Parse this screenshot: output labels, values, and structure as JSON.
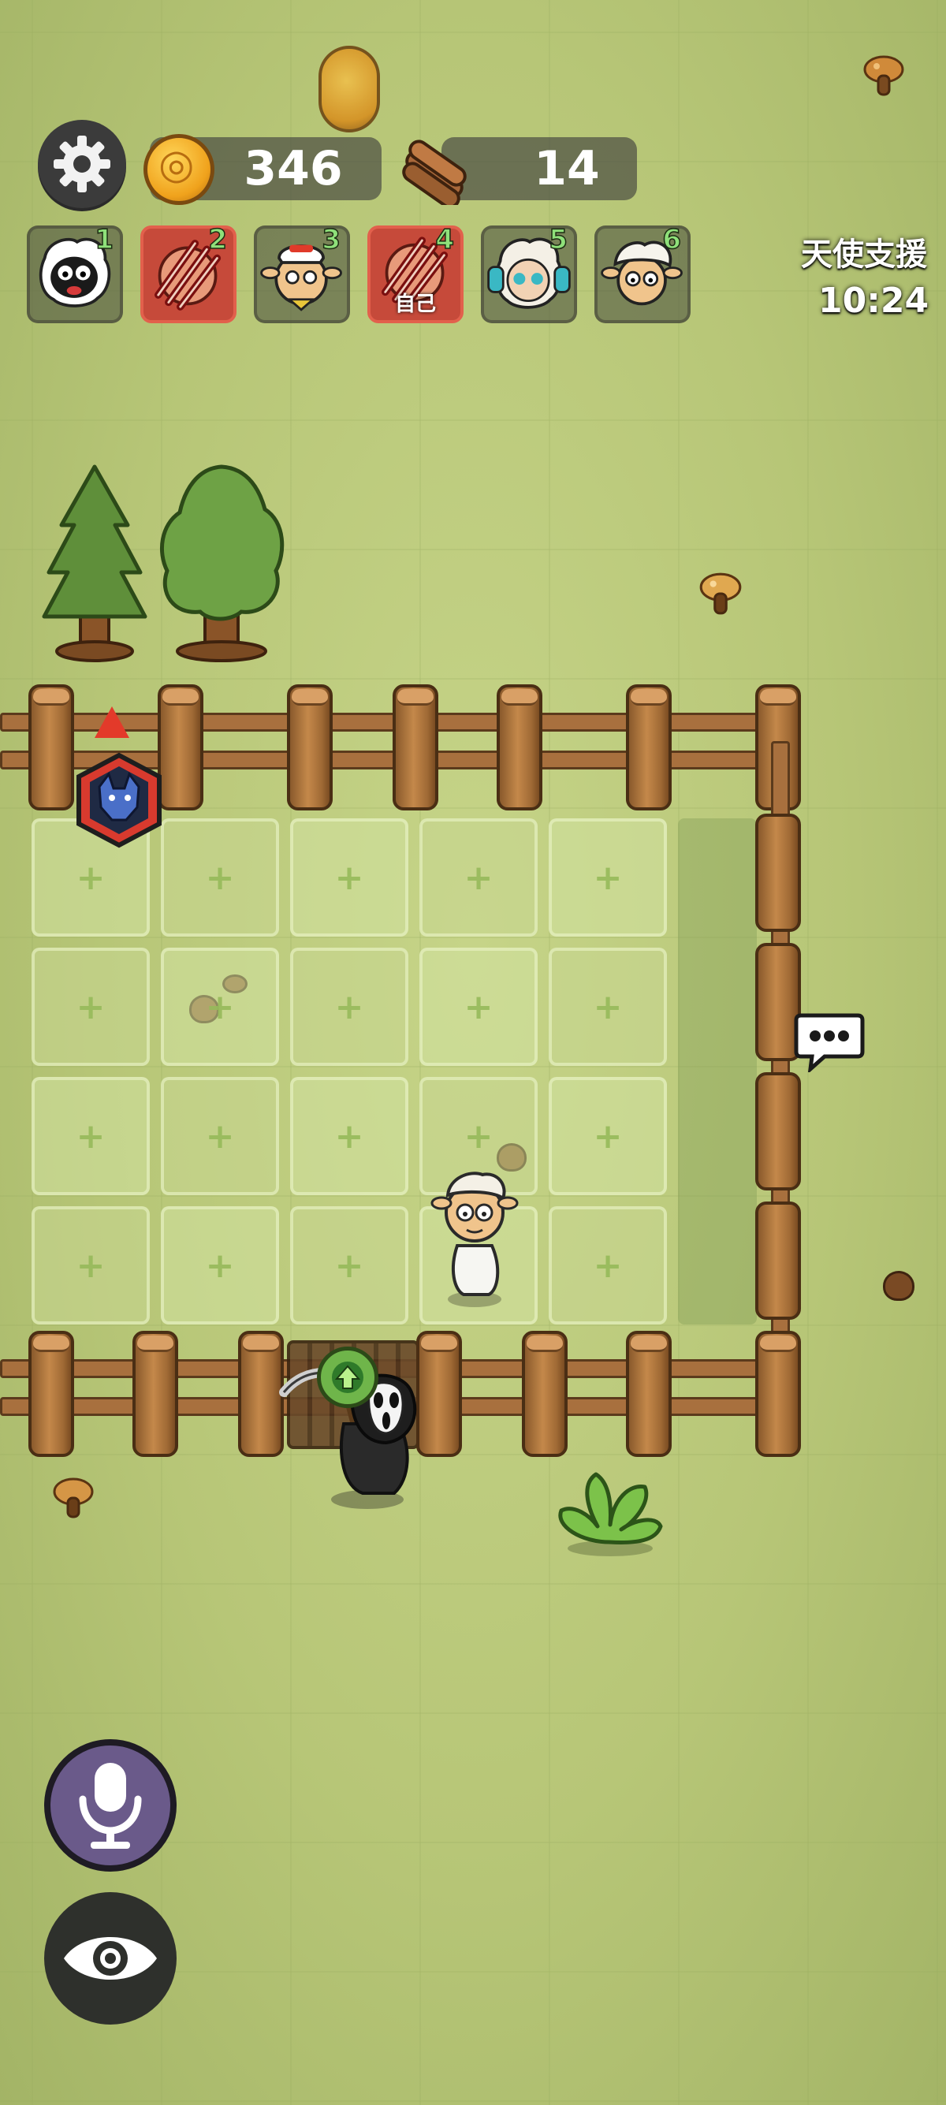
{
  "hud": {
    "coins": "346",
    "wood": "14",
    "support_label": "天使支援",
    "support_timer": "10:24"
  },
  "players": [
    {
      "number": "1",
      "icon": "black-sheep-avatar",
      "state": "normal",
      "self_label": ""
    },
    {
      "number": "2",
      "icon": "scratched-sheep-avatar",
      "state": "hurt",
      "self_label": ""
    },
    {
      "number": "3",
      "icon": "chef-sheep-avatar",
      "state": "normal",
      "self_label": ""
    },
    {
      "number": "4",
      "icon": "scratched-sheep-avatar",
      "state": "hurt",
      "self_label": "自己"
    },
    {
      "number": "5",
      "icon": "headphone-sheep-avatar",
      "state": "normal",
      "self_label": ""
    },
    {
      "number": "6",
      "icon": "white-sheep-avatar",
      "state": "normal",
      "self_label": ""
    }
  ],
  "field": {
    "plot_symbol": "+",
    "rows": 4,
    "cols": 5
  },
  "icons": {
    "settings": "gear-icon",
    "mic": "microphone-icon",
    "eye": "eye-icon",
    "chat": "chat-bubble-icon",
    "upgrade": "up-arrow-icon",
    "wolf_marker": "wolf-marker-icon"
  },
  "colors": {
    "grass": "#b9c87a",
    "hurt": "#c64a3a",
    "player_number": "#8fe07a"
  }
}
